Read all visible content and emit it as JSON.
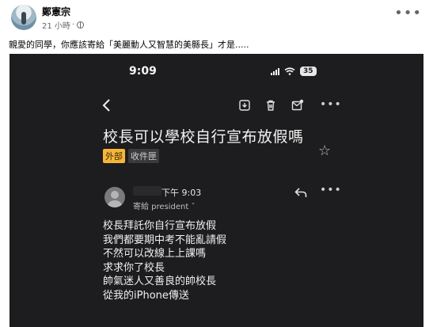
{
  "post": {
    "author": "鄭憲宗",
    "time": "21 小時",
    "caption": "親愛的同學，你應該寄給「美麗動人又智慧的美縣長」才是....."
  },
  "phone": {
    "status_time": "9:09",
    "battery": "35"
  },
  "email": {
    "subject": "校長可以學校自行宣布放假嗎",
    "labels": [
      "外部",
      "收件匣"
    ],
    "sent_time": "下午 9:03",
    "recipient": "寄給 president ˇ",
    "body": [
      "校長拜託你自行宣布放假",
      "我們都要期中考不能亂請假",
      "不然可以改線上上課嗎",
      "求求你了校長",
      "帥氣迷人又善良的帥校長",
      "從我的iPhone傳送"
    ]
  },
  "colors": {
    "phone_bg": "#1d1d1f",
    "label_external": "#f6b63a",
    "label_inbox": "#3a3a3c"
  }
}
